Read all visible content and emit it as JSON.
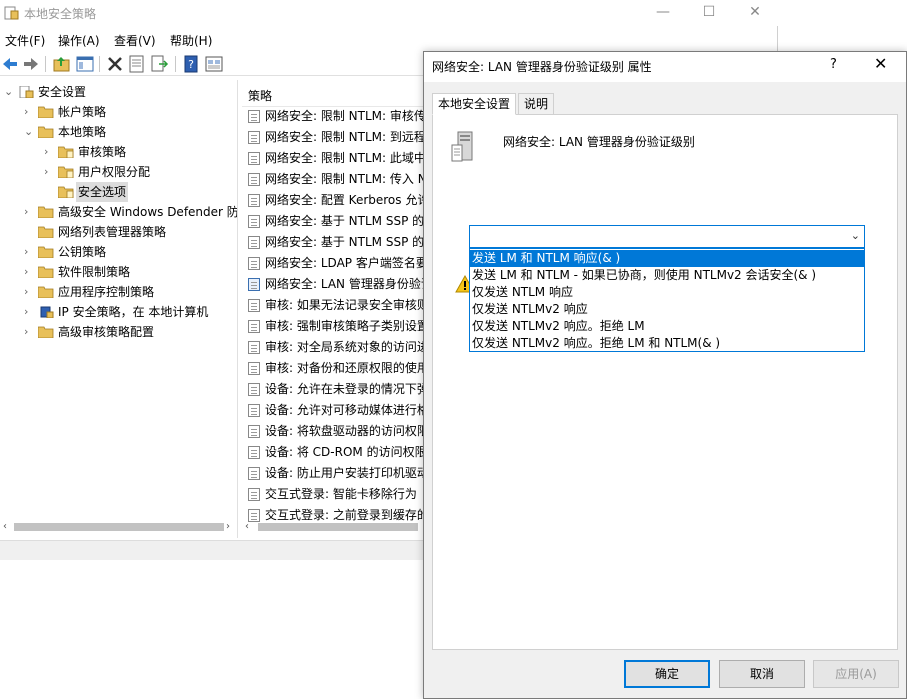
{
  "window": {
    "title": "本地安全策略",
    "minimize": "—",
    "maximize": "☐",
    "close": "✕"
  },
  "menu": {
    "file": "文件(F)",
    "action": "操作(A)",
    "view": "查看(V)",
    "help": "帮助(H)"
  },
  "tree": {
    "items": [
      {
        "label": "安全设置",
        "level": 0,
        "chevron": "⌄"
      },
      {
        "label": "帐户策略",
        "level": 1,
        "chevron": "›"
      },
      {
        "label": "本地策略",
        "level": 1,
        "chevron": "⌄"
      },
      {
        "label": "审核策略",
        "level": 2,
        "chevron": "›"
      },
      {
        "label": "用户权限分配",
        "level": 2,
        "chevron": "›"
      },
      {
        "label": "安全选项",
        "level": 2,
        "chevron": ""
      },
      {
        "label": "高级安全 Windows Defender 防火墙",
        "level": 1,
        "chevron": "›"
      },
      {
        "label": "网络列表管理器策略",
        "level": 1,
        "chevron": ""
      },
      {
        "label": "公钥策略",
        "level": 1,
        "chevron": "›"
      },
      {
        "label": "软件限制策略",
        "level": 1,
        "chevron": "›"
      },
      {
        "label": "应用程序控制策略",
        "level": 1,
        "chevron": "›"
      },
      {
        "label": "IP 安全策略，在 本地计算机",
        "level": 1,
        "chevron": "›"
      },
      {
        "label": "高级审核策略配置",
        "level": 1,
        "chevron": "›"
      }
    ]
  },
  "list": {
    "header": "策略",
    "rows": [
      "网络安全: 限制 NTLM: 审核传入 NTLM 流量",
      "网络安全: 限制 NTLM: 到远程服务器的传出 NTLM 流量",
      "网络安全: 限制 NTLM: 此域中的 NTLM 身份验证",
      "网络安全: 限制 NTLM: 传入 NTLM 流量",
      "网络安全: 配置 Kerberos 允许的加密类型",
      "网络安全: 基于 NTLM SSP 的(包括安全 RPC)客户端的最小会话安全",
      "网络安全: 基于 NTLM SSP 的(包括安全 RPC)服务器的最小会话安全",
      "网络安全: LDAP 客户端签名要求",
      "网络安全: LAN 管理器身份验证级别",
      "审核: 如果无法记录安全审核则立即关闭系统",
      "审核: 强制审核策略子类别设置",
      "审核: 对全局系统对象的访问进行审核",
      "审核: 对备份和还原权限的使用进行审核",
      "设备: 允许在未登录的情况下弹出",
      "设备: 允许对可移动媒体进行格式化并弹出",
      "设备: 将软盘驱动器的访问权限仅限于本地登录的用户",
      "设备: 将 CD-ROM 的访问权限仅限于本地登录的用户",
      "设备: 防止用户安装打印机驱动程序",
      "交互式登录: 智能卡移除行为",
      "交互式登录: 之前登录到缓存的次数"
    ]
  },
  "dialog": {
    "title": "网络安全: LAN 管理器身份验证级别 属性",
    "help": "?",
    "close": "✕",
    "tabs": [
      "本地安全设置",
      "说明"
    ],
    "policy_name": "网络安全: LAN 管理器身份验证级别",
    "combo_value": "",
    "options": [
      "发送 LM 和 NTLM 响应(& )",
      "发送 LM 和 NTLM - 如果已协商，则使用 NTLMv2 会话安全(& )",
      "仅发送 NTLM 响应",
      "仅发送 NTLMv2 响应",
      "仅发送 NTLMv2 响应。拒绝 LM",
      "仅发送 NTLMv2 响应。拒绝 LM 和 NTLM(& )"
    ],
    "selected_option_index": 0,
    "buttons": {
      "ok": "确定",
      "cancel": "取消",
      "apply": "应用(A)"
    }
  },
  "colors": {
    "accent": "#0078d7",
    "folder": "#e8c05a"
  }
}
